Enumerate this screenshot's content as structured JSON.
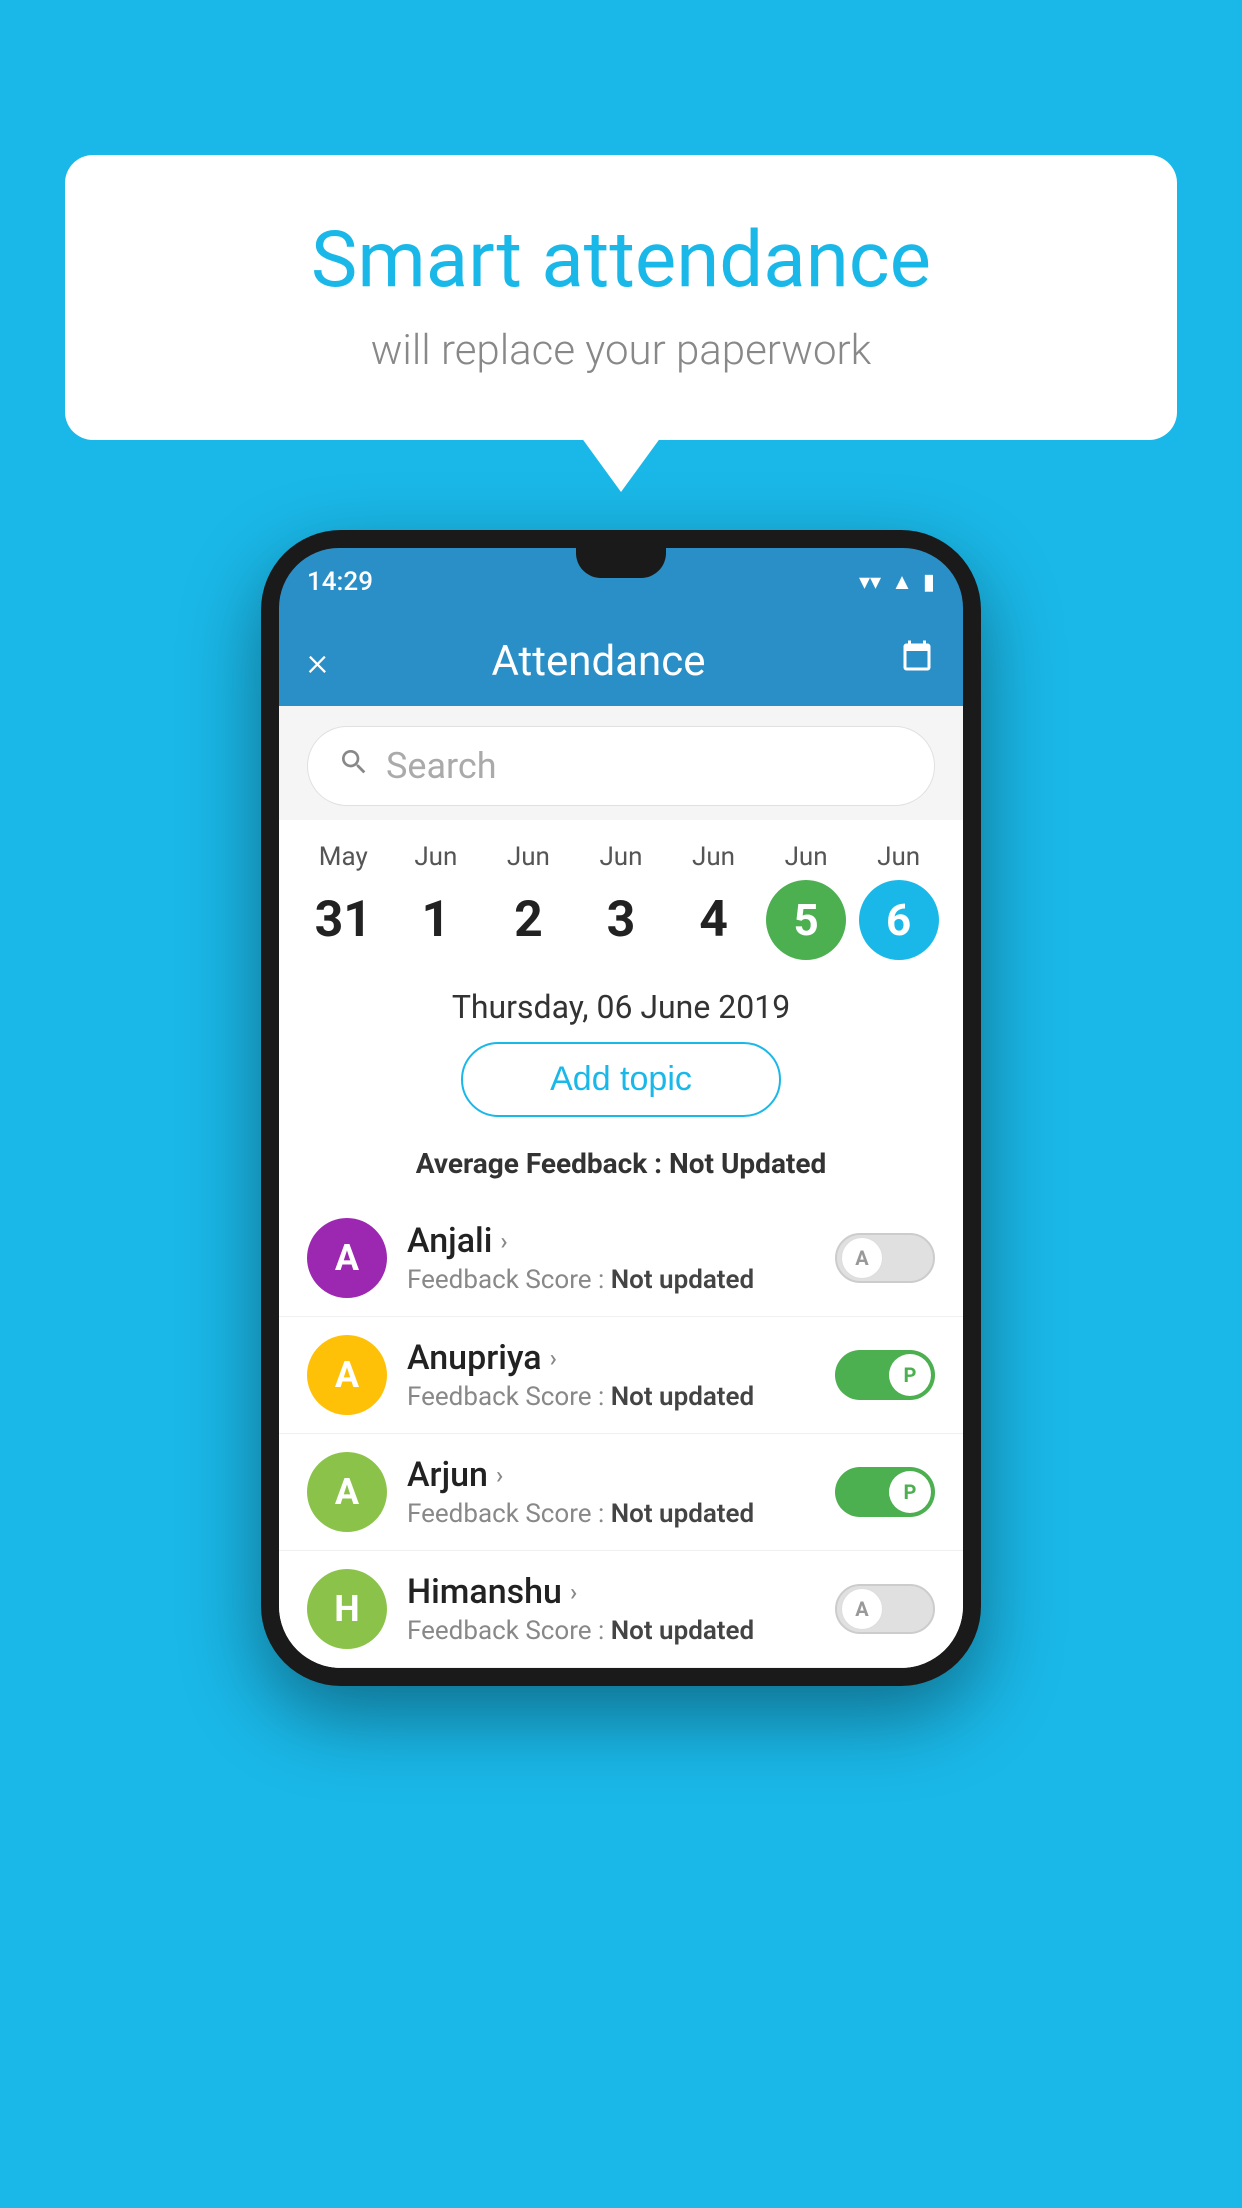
{
  "background_color": "#1ab8e8",
  "speech_bubble": {
    "title": "Smart attendance",
    "subtitle": "will replace your paperwork"
  },
  "phone": {
    "status_bar": {
      "time": "14:29",
      "wifi_icon": "wifi",
      "signal_icon": "signal",
      "battery_icon": "battery"
    },
    "app_bar": {
      "title": "Attendance",
      "close_label": "×",
      "calendar_icon": "calendar"
    },
    "search": {
      "placeholder": "Search"
    },
    "dates": [
      {
        "month": "May",
        "day": "31",
        "style": "normal"
      },
      {
        "month": "Jun",
        "day": "1",
        "style": "normal"
      },
      {
        "month": "Jun",
        "day": "2",
        "style": "normal"
      },
      {
        "month": "Jun",
        "day": "3",
        "style": "normal"
      },
      {
        "month": "Jun",
        "day": "4",
        "style": "normal"
      },
      {
        "month": "Jun",
        "day": "5",
        "style": "green"
      },
      {
        "month": "Jun",
        "day": "6",
        "style": "blue"
      }
    ],
    "selected_date_label": "Thursday, 06 June 2019",
    "add_topic_label": "Add topic",
    "avg_feedback_label": "Average Feedback :",
    "avg_feedback_value": "Not Updated",
    "students": [
      {
        "name": "Anjali",
        "avatar_letter": "A",
        "avatar_color": "#9c27b0",
        "score_label": "Feedback Score :",
        "score_value": "Not updated",
        "toggle": "off",
        "toggle_letter": "A"
      },
      {
        "name": "Anupriya",
        "avatar_letter": "A",
        "avatar_color": "#ffc107",
        "score_label": "Feedback Score :",
        "score_value": "Not updated",
        "toggle": "on",
        "toggle_letter": "P"
      },
      {
        "name": "Arjun",
        "avatar_letter": "A",
        "avatar_color": "#8bc34a",
        "score_label": "Feedback Score :",
        "score_value": "Not updated",
        "toggle": "on",
        "toggle_letter": "P"
      },
      {
        "name": "Himanshu",
        "avatar_letter": "H",
        "avatar_color": "#8bc34a",
        "score_label": "Feedback Score :",
        "score_value": "Not updated",
        "toggle": "off",
        "toggle_letter": "A"
      }
    ]
  }
}
